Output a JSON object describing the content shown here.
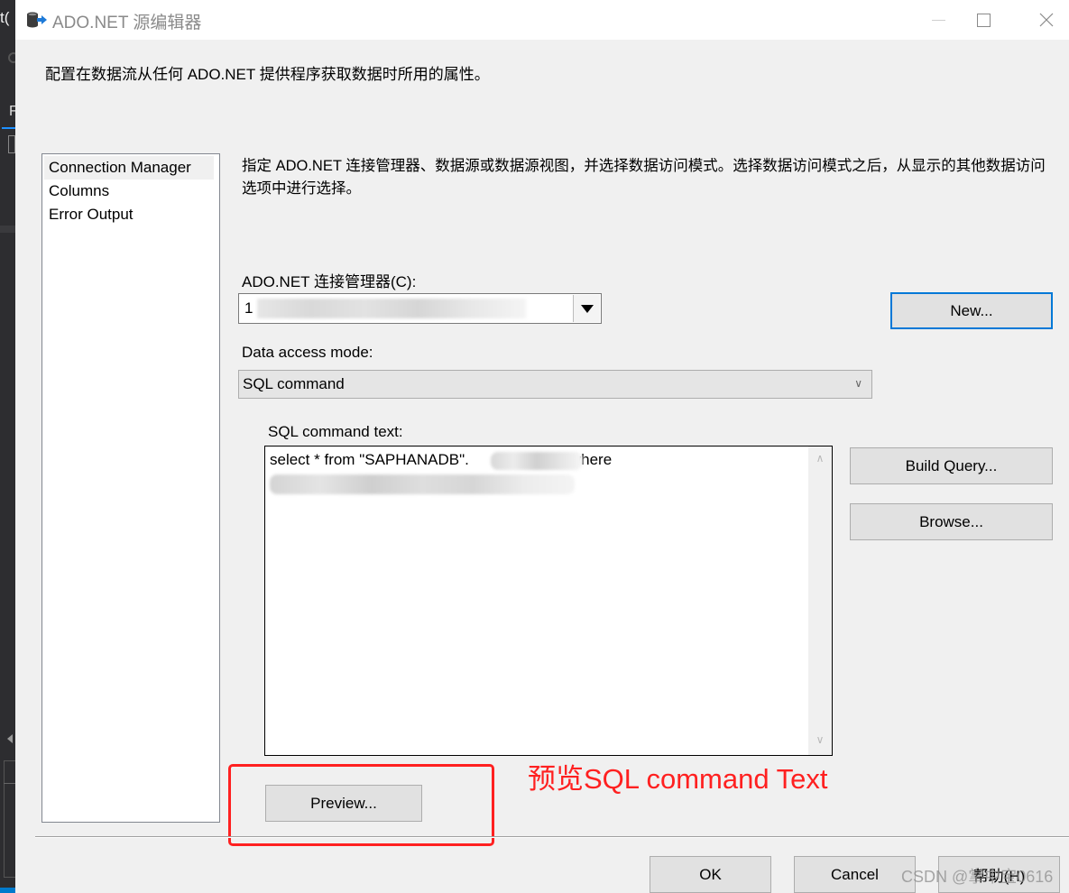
{
  "background_ide": {
    "visible_text": "t(",
    "tab_letter": "F"
  },
  "window": {
    "title": "ADO.NET 源编辑器",
    "icon": "ado-net-source-icon",
    "controls": {
      "minimize": "minimize-icon",
      "maximize": "maximize-icon",
      "close": "close-icon"
    }
  },
  "intro": "配置在数据流从任何 ADO.NET 提供程序获取数据时所用的属性。",
  "nav": {
    "items": [
      {
        "label": "Connection Manager",
        "selected": true
      },
      {
        "label": "Columns",
        "selected": false
      },
      {
        "label": "Error Output",
        "selected": false
      }
    ]
  },
  "main": {
    "description": "指定 ADO.NET 连接管理器、数据源或数据源视图，并选择数据访问模式。选择数据访问模式之后，从显示的其他数据访问选项中进行选择。",
    "connection_label": "ADO.NET 连接管理器(C):",
    "connection_value": "1",
    "connection_value_redacted": true,
    "new_button": "New...",
    "access_mode_label": "Data access mode:",
    "access_mode_value": "SQL command",
    "sql_label": "SQL command text:",
    "sql_text_line1_prefix": "select * from \"SAPHANADB\".",
    "sql_text_line1_suffix": "where",
    "sql_text_redacted": true,
    "build_query_button": "Build Query...",
    "browse_button": "Browse...",
    "preview_button": "Preview..."
  },
  "annotation": {
    "text": "预览SQL command Text",
    "color": "#ff2020"
  },
  "footer": {
    "ok": "OK",
    "cancel": "Cancel",
    "help": "帮助(H)"
  },
  "watermark": "CSDN @掌中宝0616",
  "colors": {
    "dialog_bg": "#f0f0f0",
    "focus_border": "#0078d7",
    "button_bg": "#e1e1e1"
  }
}
